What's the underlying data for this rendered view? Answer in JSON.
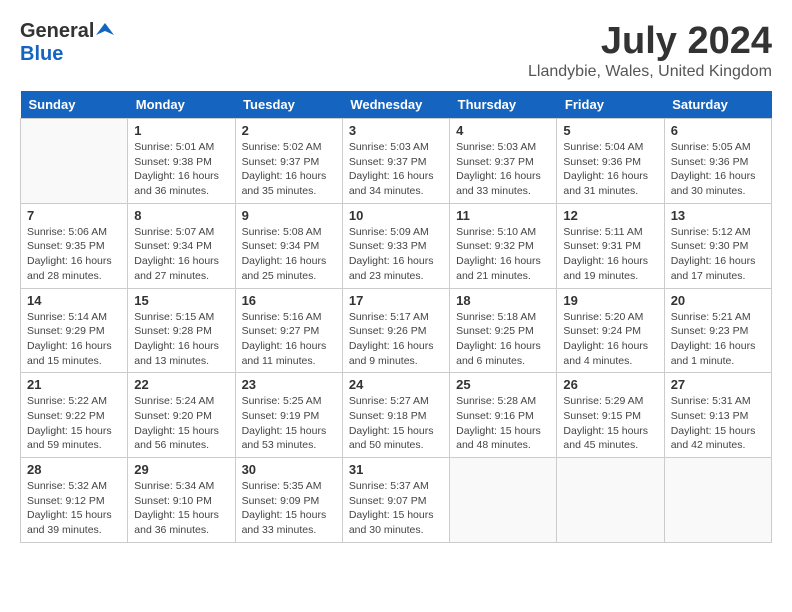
{
  "header": {
    "logo_general": "General",
    "logo_blue": "Blue",
    "month_year": "July 2024",
    "location": "Llandybie, Wales, United Kingdom"
  },
  "weekdays": [
    "Sunday",
    "Monday",
    "Tuesday",
    "Wednesday",
    "Thursday",
    "Friday",
    "Saturday"
  ],
  "weeks": [
    [
      {
        "day": "",
        "info": ""
      },
      {
        "day": "1",
        "info": "Sunrise: 5:01 AM\nSunset: 9:38 PM\nDaylight: 16 hours\nand 36 minutes."
      },
      {
        "day": "2",
        "info": "Sunrise: 5:02 AM\nSunset: 9:37 PM\nDaylight: 16 hours\nand 35 minutes."
      },
      {
        "day": "3",
        "info": "Sunrise: 5:03 AM\nSunset: 9:37 PM\nDaylight: 16 hours\nand 34 minutes."
      },
      {
        "day": "4",
        "info": "Sunrise: 5:03 AM\nSunset: 9:37 PM\nDaylight: 16 hours\nand 33 minutes."
      },
      {
        "day": "5",
        "info": "Sunrise: 5:04 AM\nSunset: 9:36 PM\nDaylight: 16 hours\nand 31 minutes."
      },
      {
        "day": "6",
        "info": "Sunrise: 5:05 AM\nSunset: 9:36 PM\nDaylight: 16 hours\nand 30 minutes."
      }
    ],
    [
      {
        "day": "7",
        "info": "Sunrise: 5:06 AM\nSunset: 9:35 PM\nDaylight: 16 hours\nand 28 minutes."
      },
      {
        "day": "8",
        "info": "Sunrise: 5:07 AM\nSunset: 9:34 PM\nDaylight: 16 hours\nand 27 minutes."
      },
      {
        "day": "9",
        "info": "Sunrise: 5:08 AM\nSunset: 9:34 PM\nDaylight: 16 hours\nand 25 minutes."
      },
      {
        "day": "10",
        "info": "Sunrise: 5:09 AM\nSunset: 9:33 PM\nDaylight: 16 hours\nand 23 minutes."
      },
      {
        "day": "11",
        "info": "Sunrise: 5:10 AM\nSunset: 9:32 PM\nDaylight: 16 hours\nand 21 minutes."
      },
      {
        "day": "12",
        "info": "Sunrise: 5:11 AM\nSunset: 9:31 PM\nDaylight: 16 hours\nand 19 minutes."
      },
      {
        "day": "13",
        "info": "Sunrise: 5:12 AM\nSunset: 9:30 PM\nDaylight: 16 hours\nand 17 minutes."
      }
    ],
    [
      {
        "day": "14",
        "info": "Sunrise: 5:14 AM\nSunset: 9:29 PM\nDaylight: 16 hours\nand 15 minutes."
      },
      {
        "day": "15",
        "info": "Sunrise: 5:15 AM\nSunset: 9:28 PM\nDaylight: 16 hours\nand 13 minutes."
      },
      {
        "day": "16",
        "info": "Sunrise: 5:16 AM\nSunset: 9:27 PM\nDaylight: 16 hours\nand 11 minutes."
      },
      {
        "day": "17",
        "info": "Sunrise: 5:17 AM\nSunset: 9:26 PM\nDaylight: 16 hours\nand 9 minutes."
      },
      {
        "day": "18",
        "info": "Sunrise: 5:18 AM\nSunset: 9:25 PM\nDaylight: 16 hours\nand 6 minutes."
      },
      {
        "day": "19",
        "info": "Sunrise: 5:20 AM\nSunset: 9:24 PM\nDaylight: 16 hours\nand 4 minutes."
      },
      {
        "day": "20",
        "info": "Sunrise: 5:21 AM\nSunset: 9:23 PM\nDaylight: 16 hours\nand 1 minute."
      }
    ],
    [
      {
        "day": "21",
        "info": "Sunrise: 5:22 AM\nSunset: 9:22 PM\nDaylight: 15 hours\nand 59 minutes."
      },
      {
        "day": "22",
        "info": "Sunrise: 5:24 AM\nSunset: 9:20 PM\nDaylight: 15 hours\nand 56 minutes."
      },
      {
        "day": "23",
        "info": "Sunrise: 5:25 AM\nSunset: 9:19 PM\nDaylight: 15 hours\nand 53 minutes."
      },
      {
        "day": "24",
        "info": "Sunrise: 5:27 AM\nSunset: 9:18 PM\nDaylight: 15 hours\nand 50 minutes."
      },
      {
        "day": "25",
        "info": "Sunrise: 5:28 AM\nSunset: 9:16 PM\nDaylight: 15 hours\nand 48 minutes."
      },
      {
        "day": "26",
        "info": "Sunrise: 5:29 AM\nSunset: 9:15 PM\nDaylight: 15 hours\nand 45 minutes."
      },
      {
        "day": "27",
        "info": "Sunrise: 5:31 AM\nSunset: 9:13 PM\nDaylight: 15 hours\nand 42 minutes."
      }
    ],
    [
      {
        "day": "28",
        "info": "Sunrise: 5:32 AM\nSunset: 9:12 PM\nDaylight: 15 hours\nand 39 minutes."
      },
      {
        "day": "29",
        "info": "Sunrise: 5:34 AM\nSunset: 9:10 PM\nDaylight: 15 hours\nand 36 minutes."
      },
      {
        "day": "30",
        "info": "Sunrise: 5:35 AM\nSunset: 9:09 PM\nDaylight: 15 hours\nand 33 minutes."
      },
      {
        "day": "31",
        "info": "Sunrise: 5:37 AM\nSunset: 9:07 PM\nDaylight: 15 hours\nand 30 minutes."
      },
      {
        "day": "",
        "info": ""
      },
      {
        "day": "",
        "info": ""
      },
      {
        "day": "",
        "info": ""
      }
    ]
  ]
}
